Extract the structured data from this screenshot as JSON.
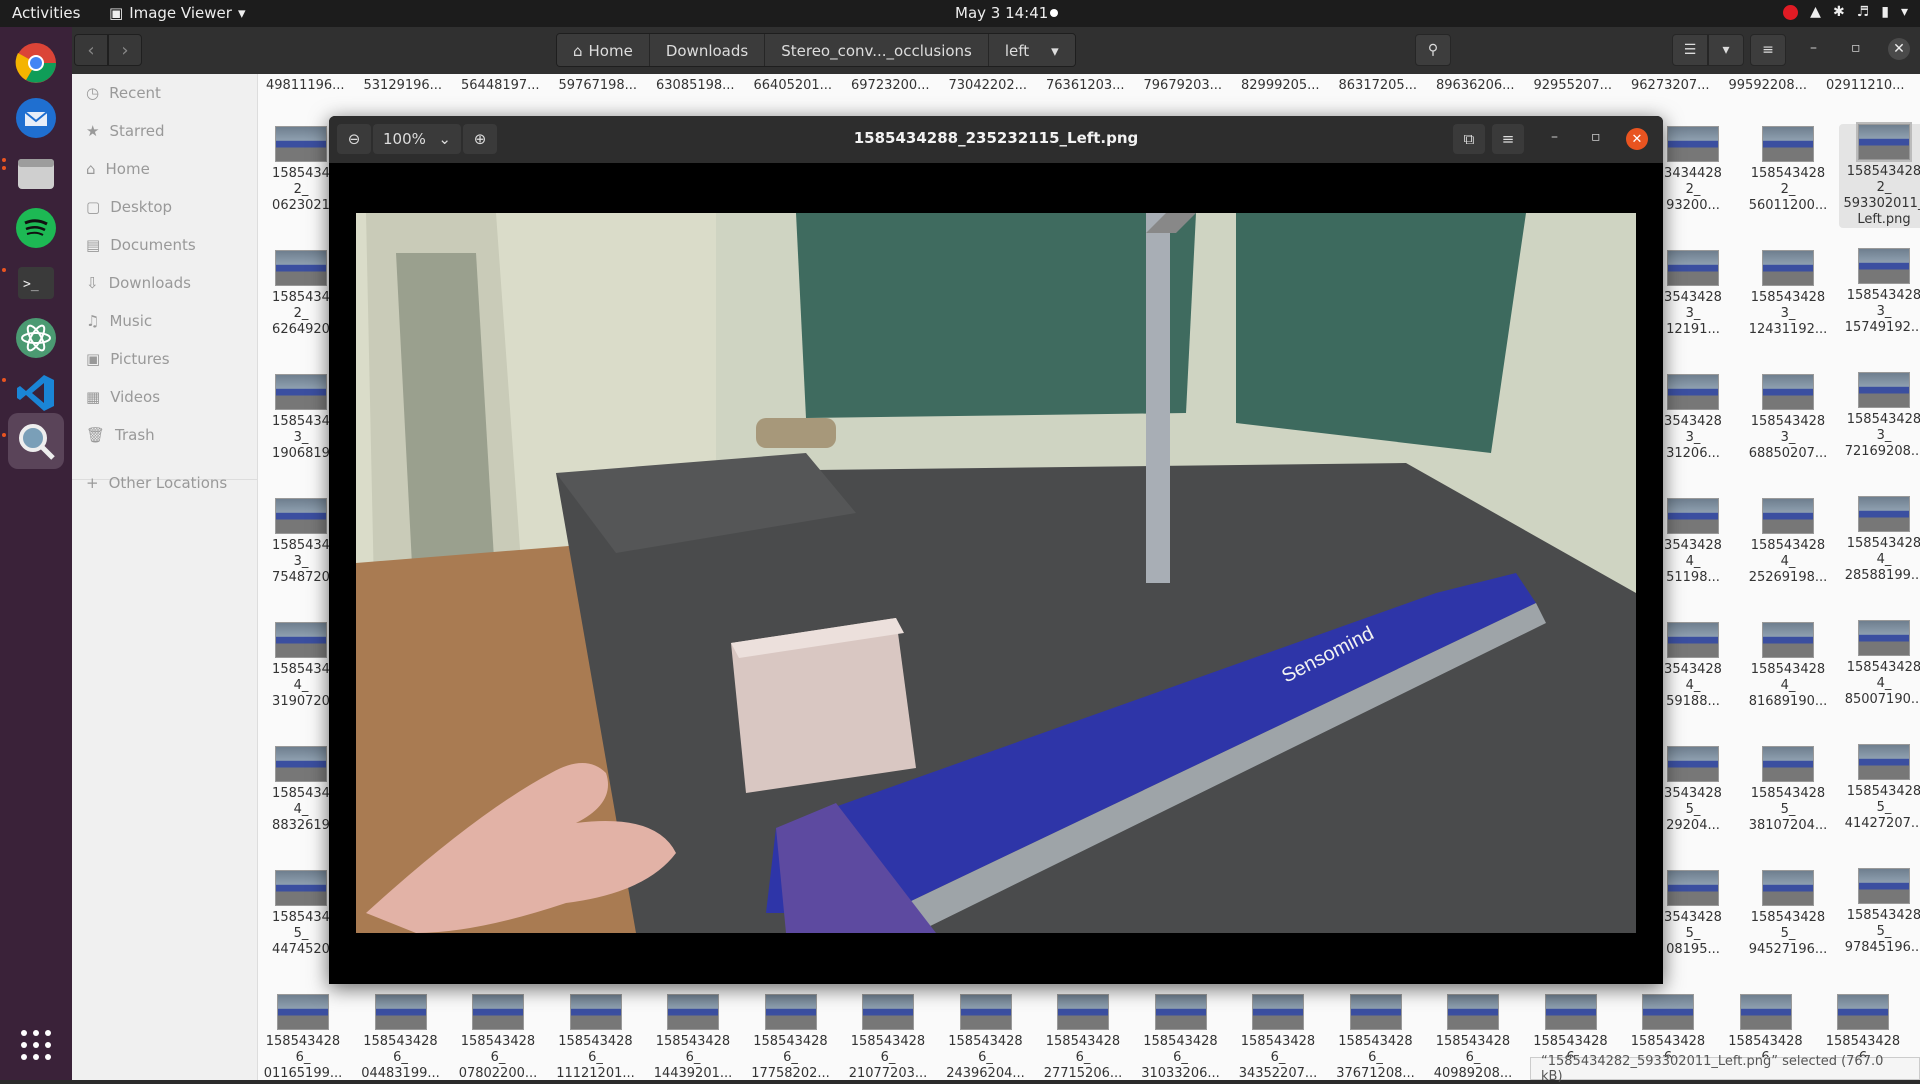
{
  "topbar": {
    "activities": "Activities",
    "app_name": "Image Viewer",
    "clock": "May 3  14:41"
  },
  "files": {
    "breadcrumbs": [
      "Home",
      "Downloads",
      "Stereo_conv..._occlusions",
      "left"
    ],
    "sidebar": [
      "Recent",
      "Starred",
      "Home",
      "Desktop",
      "Documents",
      "Downloads",
      "Music",
      "Pictures",
      "Videos",
      "Trash",
      "Other Locations"
    ],
    "top_row": [
      "49811196...",
      "53129196...",
      "56448197...",
      "59767198...",
      "63085198...",
      "66405201...",
      "69723200...",
      "73042202...",
      "76361203...",
      "79679203...",
      "82999205...",
      "86317205...",
      "89636206...",
      "92955207...",
      "96273207...",
      "99592208...",
      "02911210..."
    ],
    "left_col": [
      [
        "1585434",
        "2_",
        "0623021"
      ],
      [
        "1585434",
        "2_",
        "6264920"
      ],
      [
        "1585434",
        "3_",
        "1906819"
      ],
      [
        "1585434",
        "3_",
        "7548720"
      ],
      [
        "1585434",
        "4_",
        "3190720"
      ],
      [
        "1585434",
        "4_",
        "8832619"
      ],
      [
        "1585434",
        "5_",
        "4474520"
      ]
    ],
    "right_partial": [
      [
        "3434428",
        "2_",
        "93200..."
      ],
      [
        "3543428",
        "3_",
        "12191..."
      ],
      [
        "3543428",
        "3_",
        "31206..."
      ],
      [
        "3543428",
        "4_",
        "51198..."
      ],
      [
        "3543428",
        "4_",
        "59188..."
      ],
      [
        "3543428",
        "5_",
        "29204..."
      ],
      [
        "3543428",
        "5_",
        "08195..."
      ]
    ],
    "right_a": [
      [
        "158543428",
        "2_",
        "56011200..."
      ],
      [
        "158543428",
        "3_",
        "12431192..."
      ],
      [
        "158543428",
        "3_",
        "68850207..."
      ],
      [
        "158543428",
        "4_",
        "25269198..."
      ],
      [
        "158543428",
        "4_",
        "81689190..."
      ],
      [
        "158543428",
        "5_",
        "38107204..."
      ],
      [
        "158543428",
        "5_",
        "94527196..."
      ]
    ],
    "right_b": [
      [
        "158543428",
        "2_",
        "593302011_",
        "Left.png"
      ],
      [
        "158543428",
        "3_",
        "15749192..."
      ],
      [
        "158543428",
        "3_",
        "72169208..."
      ],
      [
        "158543428",
        "4_",
        "28588199..."
      ],
      [
        "158543428",
        "4_",
        "85007190..."
      ],
      [
        "158543428",
        "5_",
        "41427207..."
      ],
      [
        "158543428",
        "5_",
        "97845196..."
      ]
    ],
    "bottom_row": [
      [
        "158543428",
        "6_",
        "01165199..."
      ],
      [
        "158543428",
        "6_",
        "04483199..."
      ],
      [
        "158543428",
        "6_",
        "07802200..."
      ],
      [
        "158543428",
        "6_",
        "11121201..."
      ],
      [
        "158543428",
        "6_",
        "14439201..."
      ],
      [
        "158543428",
        "6_",
        "17758202..."
      ],
      [
        "158543428",
        "6_",
        "21077203..."
      ],
      [
        "158543428",
        "6_",
        "24396204..."
      ],
      [
        "158543428",
        "6_",
        "27715206..."
      ],
      [
        "158543428",
        "6_",
        "31033206..."
      ],
      [
        "158543428",
        "6_",
        "34352207..."
      ],
      [
        "158543428",
        "6_",
        "37671208..."
      ],
      [
        "158543428",
        "6_",
        "40989208..."
      ],
      [
        "158543428",
        "6",
        ""
      ],
      [
        "158543428",
        "6",
        ""
      ],
      [
        "158543428",
        "6",
        ""
      ],
      [
        "158543428",
        "6",
        ""
      ]
    ],
    "status": "“1585434282_593302011_Left.png” selected  (767.0 kB)"
  },
  "viewer": {
    "zoom": "100%",
    "title": "1585434288_235232115_Left.png",
    "photo_text": "Sensomind"
  }
}
